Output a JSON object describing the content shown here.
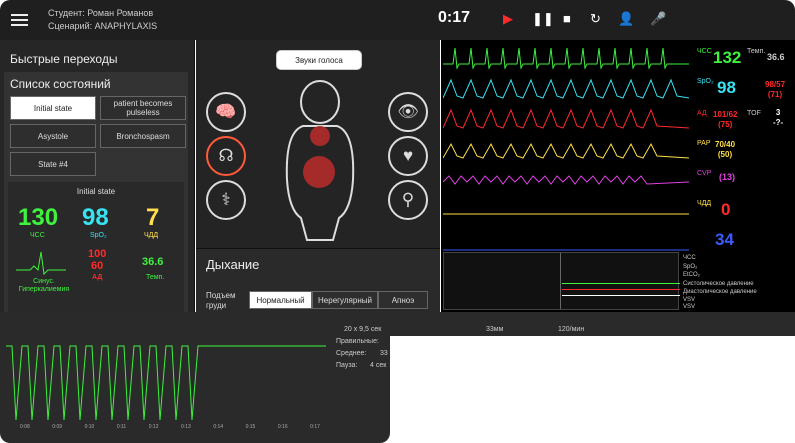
{
  "header": {
    "student_label": "Студент:",
    "student": "Роман Романов",
    "scenario_label": "Сценарий:",
    "scenario": "ANAPHYLAXIS",
    "time": "0:17"
  },
  "left": {
    "quick": "Быстрые переходы",
    "states_title": "Список состояний",
    "states": [
      "Initial state",
      "patient becomes pulseless",
      "Asystole",
      "Bronchospasm",
      "State #4"
    ],
    "panel_title": "Initial state",
    "hr": "130",
    "hr_l": "ЧСС",
    "spo2": "98",
    "spo2_l": "SpO₂",
    "rr": "7",
    "rr_l": "ЧДД",
    "rhythm": "Синус.\nГиперкалиемия",
    "bp_s": "100",
    "bp_d": "60",
    "bp_l": "АД",
    "temp": "36.6",
    "temp_l": "Темп."
  },
  "mid": {
    "voice": "Звуки голоса",
    "breath": "Дыхание",
    "chest": "Подъем груди",
    "modes": [
      "Нормальный",
      "Нерегулярный",
      "Апноэ"
    ]
  },
  "monitor": {
    "hr": "132",
    "spo2": "98",
    "abp": "101/62",
    "abp2": "(75)",
    "pap": "70/40",
    "pap2": "(50)",
    "cvp": "(13)",
    "rr": "0",
    "co2": "34",
    "t": "36.6",
    "nibp": "98/57",
    "nibp2": "(71)",
    "tof": "3",
    "tof2": "-?-",
    "temp_l": "Темп.",
    "tof_l": "TOF",
    "hr_l": "ЧСС",
    "spo2_l": "SpO₂",
    "abp_l": "АД",
    "pap_l": "PAP",
    "cvp_l": "CVP",
    "rr_l": "ЧДД"
  },
  "legend": [
    "ЧСС",
    "SpO₂",
    "EtCO₂",
    "Систолическое давление",
    "Диастолическое давление",
    "VSV",
    "VSV"
  ],
  "ecg": {
    "info1": "20 x 9,5 сек",
    "info2": "Правильные:",
    "info3": "Среднее:",
    "info3v": "33",
    "info4": "Пауза:",
    "info4v": "4 сек",
    "ticks": [
      "0:08",
      "0:09",
      "0:10",
      "0:11",
      "0:12",
      "0:13",
      "0:14",
      "0:15",
      "0:16",
      "0:17"
    ],
    "speed1": "33мм",
    "speed2": "120/мин"
  },
  "colors": {
    "green": "#3ef23e",
    "cyan": "#36e3f2",
    "red": "#ff2a2a",
    "yellow": "#ffe04a",
    "magenta": "#e042e0",
    "blue": "#3a5cff"
  }
}
